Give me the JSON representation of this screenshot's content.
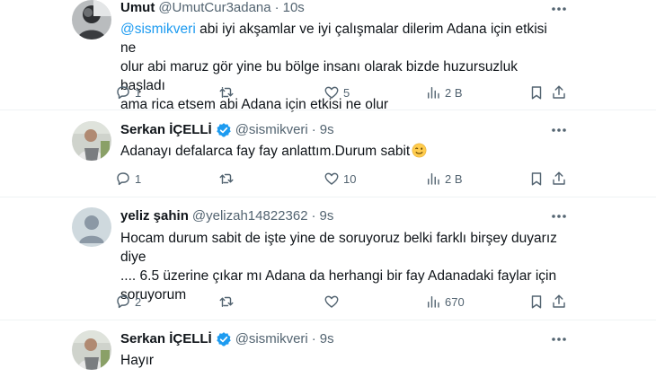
{
  "tweets": [
    {
      "name": "Umut",
      "handle": "@UmutCur3adana",
      "dot": "·",
      "time": "10s",
      "mention": "@sismikveri",
      "line1": " abi iyi akşamlar ve iyi çalışmalar dilerim Adana için etkisi ne",
      "line2": "olur abi maruz gör yine bu bölge insanı olarak bizde huzursuzluk başladı",
      "line3": "ama rica etsem abi Adana için etkisi ne olur",
      "replies": "1",
      "retweets": "",
      "likes": "5",
      "views": "2 B"
    },
    {
      "name": "Serkan İÇELLİ",
      "handle": "@sismikveri",
      "dot": "·",
      "time": "9s",
      "line1": "Adanayı defalarca fay fay anlattım.Durum sabit",
      "replies": "1",
      "retweets": "",
      "likes": "10",
      "views": "2 B"
    },
    {
      "name": "yeliz şahin",
      "handle": "@yelizah14822362",
      "dot": "·",
      "time": "9s",
      "line1": "Hocam durum sabit de işte yine de soruyoruz belki farklı birşey duyarız diye",
      "line2": ".... 6.5 üzerine çıkar mı Adana da herhangi bir fay Adanadaki faylar için",
      "line3": "soruyorum",
      "replies": "2",
      "retweets": "",
      "likes": "",
      "views": "670"
    },
    {
      "name": "Serkan İÇELLİ",
      "handle": "@sismikveri",
      "dot": "·",
      "time": "9s",
      "line1": "Hayır"
    }
  ],
  "icons": {
    "reply": "reply-icon",
    "retweet": "retweet-icon",
    "like": "like-icon",
    "views": "views-icon",
    "bookmark": "bookmark-icon",
    "share": "share-icon",
    "verified": "verified-badge-icon",
    "more": "more-options-icon"
  },
  "colors": {
    "accent": "#1d9bf0",
    "text": "#0f1419",
    "muted": "#536471",
    "divider": "#eff3f4"
  }
}
